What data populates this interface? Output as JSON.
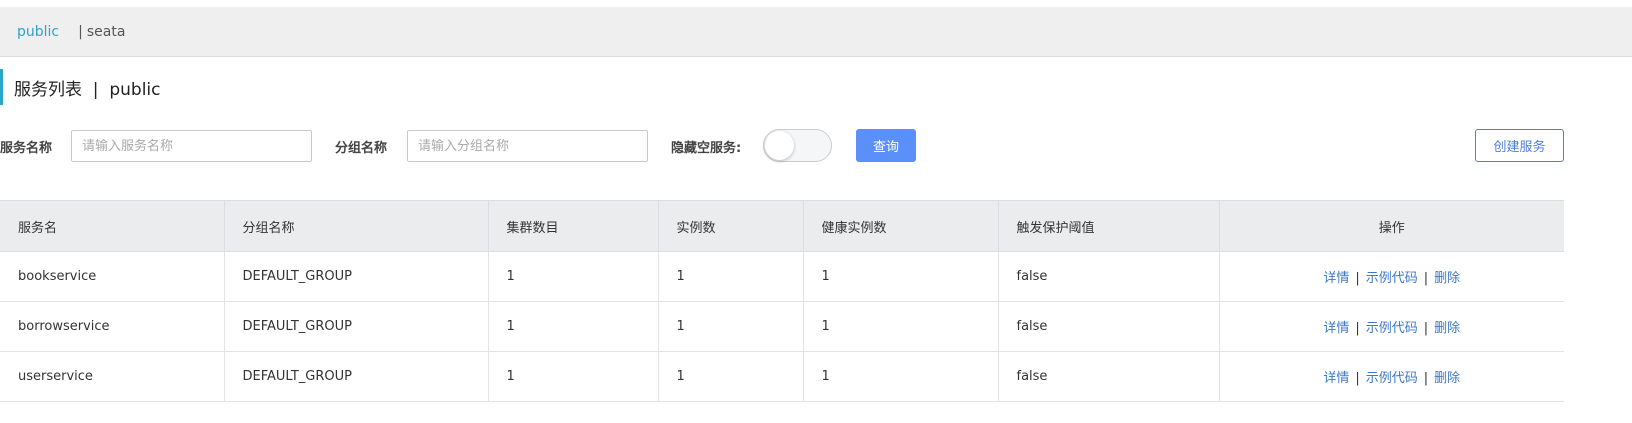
{
  "namespaces": {
    "active": "public",
    "separator": "|",
    "other": "seata"
  },
  "title": {
    "text": "服务列表  |  public"
  },
  "filters": {
    "service_name_label": "服务名称",
    "service_name_placeholder": "请输入服务名称",
    "group_name_label": "分组名称",
    "group_name_placeholder": "请输入分组名称",
    "hide_empty_label": "隐藏空服务:",
    "hide_empty_on": false,
    "query_label": "查询",
    "create_label": "创建服务"
  },
  "colors": {
    "accent": "#2aa6c9",
    "primary": "#5b8ff9",
    "link": "#3d78c8"
  },
  "table": {
    "headers": [
      "服务名",
      "分组名称",
      "集群数目",
      "实例数",
      "健康实例数",
      "触发保护阈值",
      "操作"
    ],
    "ops": {
      "detail": "详情",
      "sample": "示例代码",
      "delete": "删除",
      "separator": "|"
    },
    "rows": [
      {
        "name": "bookservice",
        "group": "DEFAULT_GROUP",
        "clusters": "1",
        "instances": "1",
        "healthy": "1",
        "protect": "false"
      },
      {
        "name": "borrowservice",
        "group": "DEFAULT_GROUP",
        "clusters": "1",
        "instances": "1",
        "healthy": "1",
        "protect": "false"
      },
      {
        "name": "userservice",
        "group": "DEFAULT_GROUP",
        "clusters": "1",
        "instances": "1",
        "healthy": "1",
        "protect": "false"
      }
    ]
  }
}
